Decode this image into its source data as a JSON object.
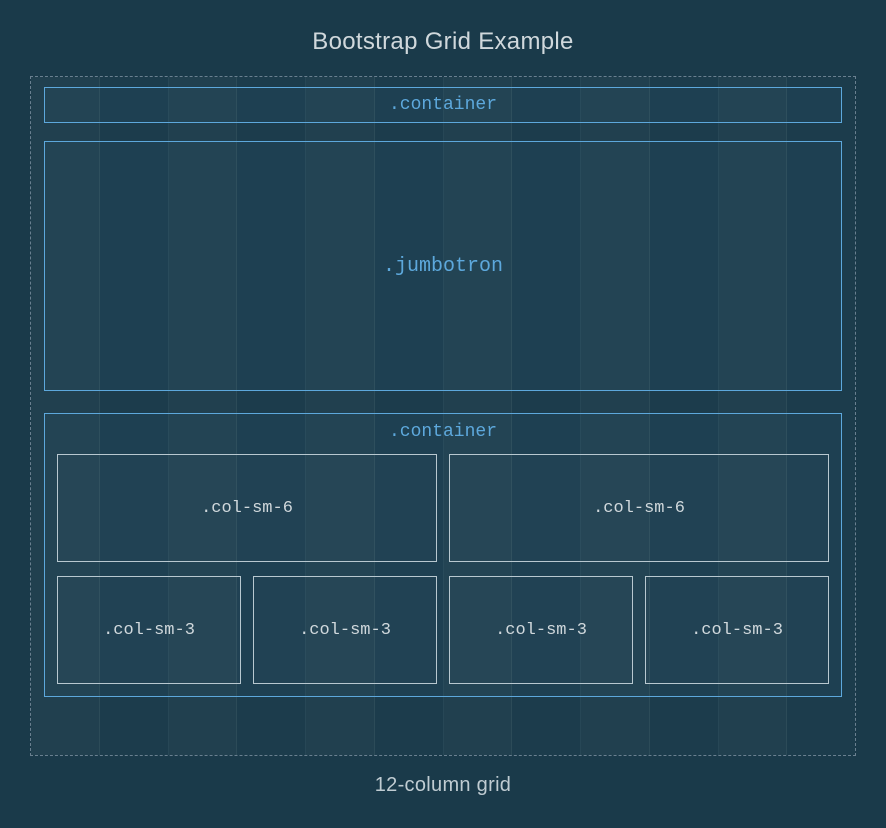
{
  "title": "Bootstrap Grid Example",
  "blocks": {
    "container_top": ".container",
    "jumbotron": ".jumbotron",
    "container_bottom": ".container"
  },
  "rows": [
    {
      "cols": [
        ".col-sm-6",
        ".col-sm-6"
      ]
    },
    {
      "cols": [
        ".col-sm-3",
        ".col-sm-3",
        ".col-sm-3",
        ".col-sm-3"
      ]
    }
  ],
  "footer": "12-column grid",
  "grid_column_count": 12,
  "colors": {
    "background": "#1a3a4a",
    "accent": "#5da8dc",
    "col_border": "#b8c8d0",
    "text": "#d0d8dc"
  }
}
